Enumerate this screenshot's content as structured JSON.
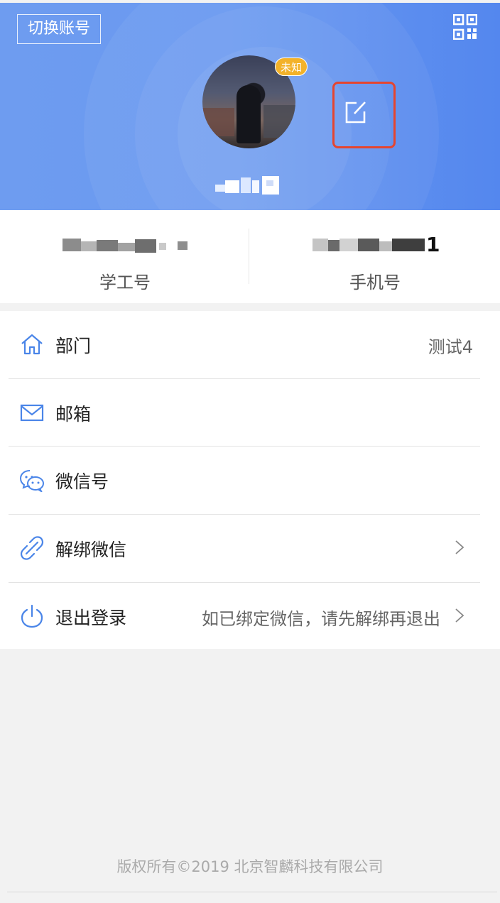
{
  "header": {
    "switch_account_label": "切换账号",
    "avatar_badge": "未知",
    "qr_icon": "qrcode-icon",
    "edit_icon": "edit-icon",
    "colors": {
      "gradient_start": "#6e9cf0",
      "gradient_end": "#5487ee",
      "badge": "#f3b22a",
      "highlight_border": "#e5452f"
    }
  },
  "info": {
    "student_id_label": "学工号",
    "phone_label": "手机号",
    "phone_tail": "1"
  },
  "menu": {
    "department": {
      "label": "部门",
      "value": "测试4",
      "icon": "home-icon"
    },
    "email": {
      "label": "邮箱",
      "icon": "mail-icon"
    },
    "wechat": {
      "label": "微信号",
      "icon": "wechat-icon"
    },
    "unbind": {
      "label": "解绑微信",
      "icon": "unlink-icon"
    },
    "logout": {
      "label": "退出登录",
      "hint": "如已绑定微信，请先解绑再退出",
      "icon": "power-icon"
    }
  },
  "footer": {
    "copyright": "版权所有©2019 北京智麟科技有限公司"
  }
}
